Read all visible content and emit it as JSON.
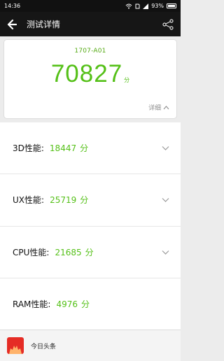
{
  "statusbar": {
    "time": "14:36",
    "battery": "93%"
  },
  "appbar": {
    "title": "测试详情"
  },
  "score": {
    "device": "1707-A01",
    "total": "70827",
    "unit": "分",
    "details": "详细"
  },
  "rows": [
    {
      "label": "3D性能:",
      "value": "18447",
      "unit": "分"
    },
    {
      "label": "UX性能:",
      "value": "25719",
      "unit": "分"
    },
    {
      "label": "CPU性能:",
      "value": "21685",
      "unit": "分"
    },
    {
      "label": "RAM性能:",
      "value": "4976",
      "unit": "分"
    }
  ],
  "footer": {
    "label": "今日头条"
  }
}
